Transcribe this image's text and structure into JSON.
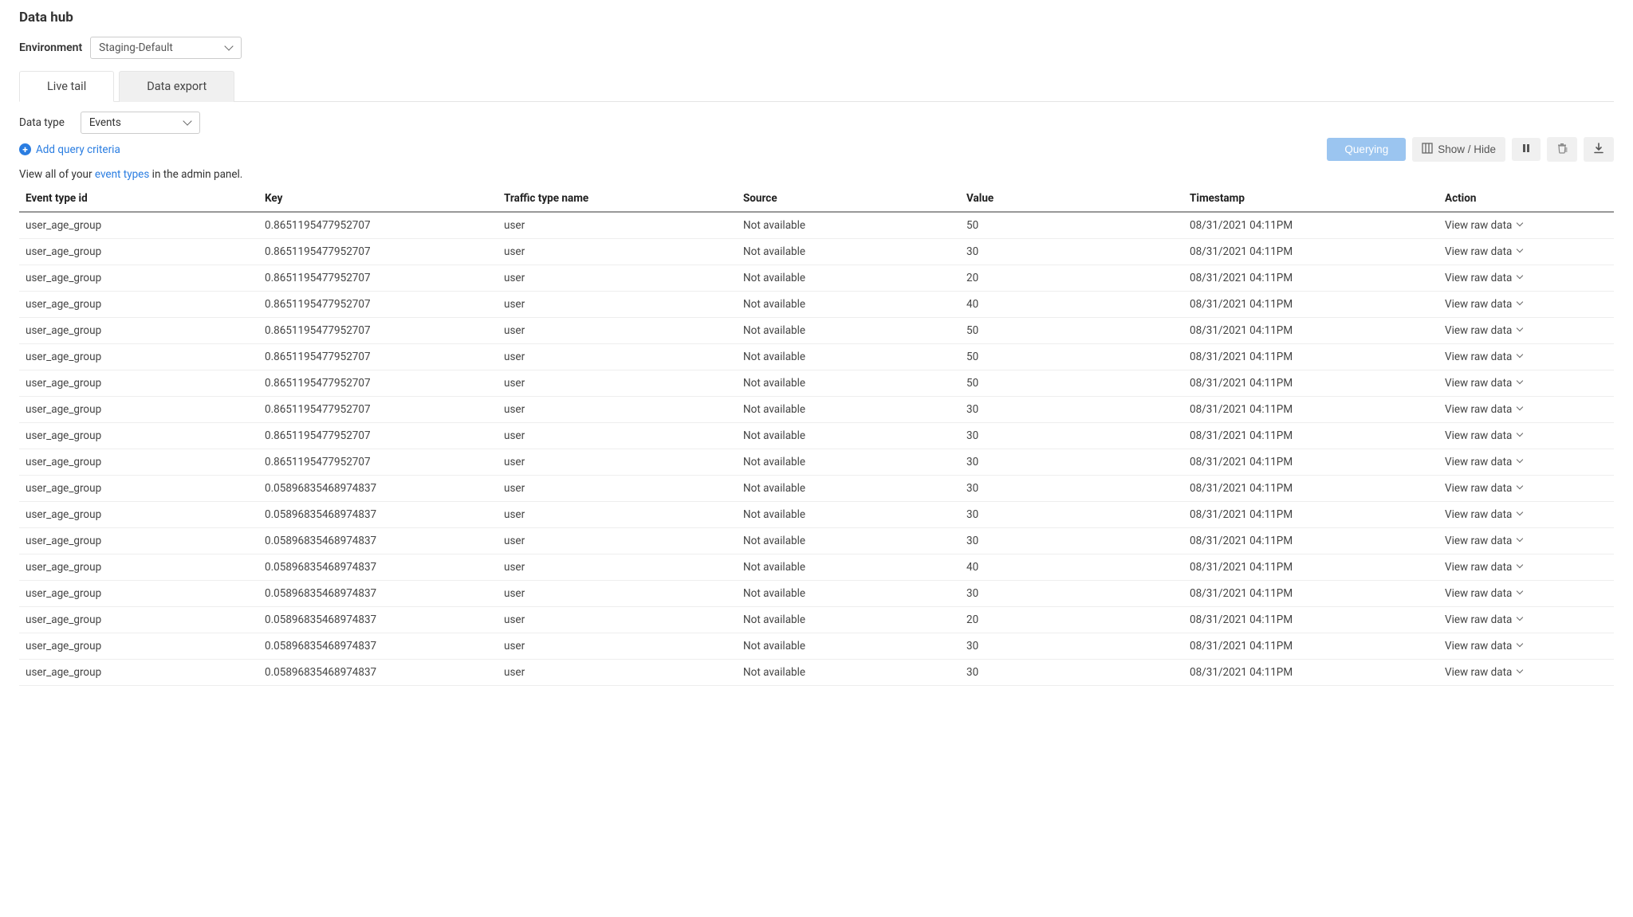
{
  "page": {
    "title": "Data hub",
    "env_label": "Environment",
    "env_value": "Staging-Default"
  },
  "tabs": [
    {
      "label": "Live tail",
      "active": true
    },
    {
      "label": "Data export",
      "active": false
    }
  ],
  "data_type": {
    "label": "Data type",
    "value": "Events"
  },
  "add_criteria": {
    "label": "Add query criteria"
  },
  "help": {
    "pre": "View all of your ",
    "link": "event types",
    "post": " in the admin panel."
  },
  "buttons": {
    "querying": "Querying",
    "showhide": "Show / Hide"
  },
  "columns": {
    "event_type_id": "Event type id",
    "key": "Key",
    "traffic_type_name": "Traffic type name",
    "source": "Source",
    "value": "Value",
    "timestamp": "Timestamp",
    "action": "Action"
  },
  "action_label": "View raw data",
  "rows": [
    {
      "id": "user_age_group",
      "key": "0.8651195477952707",
      "ttn": "user",
      "source": "Not available",
      "value": "50",
      "ts": "08/31/2021 04:11PM"
    },
    {
      "id": "user_age_group",
      "key": "0.8651195477952707",
      "ttn": "user",
      "source": "Not available",
      "value": "30",
      "ts": "08/31/2021 04:11PM"
    },
    {
      "id": "user_age_group",
      "key": "0.8651195477952707",
      "ttn": "user",
      "source": "Not available",
      "value": "20",
      "ts": "08/31/2021 04:11PM"
    },
    {
      "id": "user_age_group",
      "key": "0.8651195477952707",
      "ttn": "user",
      "source": "Not available",
      "value": "40",
      "ts": "08/31/2021 04:11PM"
    },
    {
      "id": "user_age_group",
      "key": "0.8651195477952707",
      "ttn": "user",
      "source": "Not available",
      "value": "50",
      "ts": "08/31/2021 04:11PM"
    },
    {
      "id": "user_age_group",
      "key": "0.8651195477952707",
      "ttn": "user",
      "source": "Not available",
      "value": "50",
      "ts": "08/31/2021 04:11PM"
    },
    {
      "id": "user_age_group",
      "key": "0.8651195477952707",
      "ttn": "user",
      "source": "Not available",
      "value": "50",
      "ts": "08/31/2021 04:11PM"
    },
    {
      "id": "user_age_group",
      "key": "0.8651195477952707",
      "ttn": "user",
      "source": "Not available",
      "value": "30",
      "ts": "08/31/2021 04:11PM"
    },
    {
      "id": "user_age_group",
      "key": "0.8651195477952707",
      "ttn": "user",
      "source": "Not available",
      "value": "30",
      "ts": "08/31/2021 04:11PM"
    },
    {
      "id": "user_age_group",
      "key": "0.8651195477952707",
      "ttn": "user",
      "source": "Not available",
      "value": "30",
      "ts": "08/31/2021 04:11PM"
    },
    {
      "id": "user_age_group",
      "key": "0.05896835468974837",
      "ttn": "user",
      "source": "Not available",
      "value": "30",
      "ts": "08/31/2021 04:11PM"
    },
    {
      "id": "user_age_group",
      "key": "0.05896835468974837",
      "ttn": "user",
      "source": "Not available",
      "value": "30",
      "ts": "08/31/2021 04:11PM"
    },
    {
      "id": "user_age_group",
      "key": "0.05896835468974837",
      "ttn": "user",
      "source": "Not available",
      "value": "30",
      "ts": "08/31/2021 04:11PM"
    },
    {
      "id": "user_age_group",
      "key": "0.05896835468974837",
      "ttn": "user",
      "source": "Not available",
      "value": "40",
      "ts": "08/31/2021 04:11PM"
    },
    {
      "id": "user_age_group",
      "key": "0.05896835468974837",
      "ttn": "user",
      "source": "Not available",
      "value": "30",
      "ts": "08/31/2021 04:11PM"
    },
    {
      "id": "user_age_group",
      "key": "0.05896835468974837",
      "ttn": "user",
      "source": "Not available",
      "value": "20",
      "ts": "08/31/2021 04:11PM"
    },
    {
      "id": "user_age_group",
      "key": "0.05896835468974837",
      "ttn": "user",
      "source": "Not available",
      "value": "30",
      "ts": "08/31/2021 04:11PM"
    },
    {
      "id": "user_age_group",
      "key": "0.05896835468974837",
      "ttn": "user",
      "source": "Not available",
      "value": "30",
      "ts": "08/31/2021 04:11PM"
    }
  ]
}
